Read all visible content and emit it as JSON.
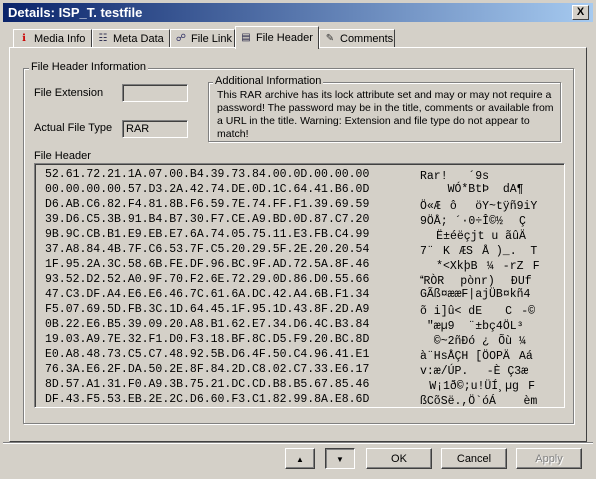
{
  "window": {
    "title": "Details: ISP_T. testfile",
    "close_label": "X"
  },
  "tabs": [
    {
      "label": "Media Info",
      "icon": "media-info-icon",
      "icon_glyph": "ℹ"
    },
    {
      "label": "Meta Data",
      "icon": "document-icon",
      "icon_glyph": "☷"
    },
    {
      "label": "File Link",
      "icon": "link-icon",
      "icon_glyph": "☍"
    },
    {
      "label": "File Header",
      "icon": "file-header-icon",
      "icon_glyph": "▤"
    },
    {
      "label": "Comments",
      "icon": "comments-icon",
      "icon_glyph": "✎"
    }
  ],
  "active_tab": "File Header",
  "file_header_info": {
    "group_title": "File Header Information",
    "extension_label": "File Extension",
    "extension_value": "",
    "type_label": "Actual File Type",
    "type_value": "RAR"
  },
  "additional_info": {
    "title": "Additional Information",
    "text": "This RAR archive has its lock attribute set and may or may not require a password! The password may be in the title, comments or available from a URL in the title. Warning: Extension and file type do not appear to match!"
  },
  "file_header": {
    "label": "File Header",
    "rows": [
      {
        "hex": "52.61.72.21.1A.07.00.B4.39.73.84.00.0D.00.00.00",
        "ascii": "Rar!   ´9s"
      },
      {
        "hex": "00.00.00.00.57.D3.2A.42.74.DE.0D.1C.64.41.B6.0D",
        "ascii": "    WÓ*BtÞ  dA¶"
      },
      {
        "hex": "D6.AB.C6.82.F4.81.8B.F6.59.7E.74.FF.F1.39.69.59",
        "ascii": "Ö«ÆôöY~tÿñ9iY"
      },
      {
        "hex": "39.D6.C5.3B.91.B4.B7.30.F7.CE.A9.BD.0D.87.C7.20",
        "ascii": "9ÖÅ;´·0÷Î©½ Ç "
      },
      {
        "hex": "9B.9C.CB.B1.E9.EB.E7.6A.74.05.75.11.E3.FB.C4.99",
        "ascii": "Ë±éëçjt u ãûÄ"
      },
      {
        "hex": "37.A8.84.4B.7F.C6.53.7F.C5.20.29.5F.2E.20.20.54",
        "ascii": "7¨KÆSÅ )_.  T"
      },
      {
        "hex": "1F.95.2A.3C.58.6B.FE.DF.96.BC.9F.AD.72.5A.8F.46",
        "ascii": " *<XkþB¼-rZF"
      },
      {
        "hex": "93.52.D2.52.A0.9F.70.F2.6E.72.29.0D.86.D0.55.66",
        "ascii": "RÒR pònr) ÐUf"
      },
      {
        "hex": "47.C3.DF.A4.E6.E6.46.7C.61.6A.DC.42.A4.6B.F1.34",
        "ascii": "GÃß¤ææF|ajÜB¤kñ4"
      },
      {
        "hex": "F5.07.69.5D.FB.3C.1D.64.45.1F.95.1D.43.8F.2D.A9",
        "ascii": "õ i]û< dE  C-©"
      },
      {
        "hex": "0B.22.E6.B5.39.09.20.A8.B1.62.E7.34.D6.4C.B3.84",
        "ascii": " \"æµ9  ¨±bç4ÖL³"
      },
      {
        "hex": "19.03.A9.7E.32.F1.D0.F3.18.BF.8C.D5.F9.20.BC.8D",
        "ascii": "  ©~2ñÐó ¿Õù ¼"
      },
      {
        "hex": "E0.A8.48.73.C5.C7.48.92.5B.D6.4F.50.C4.96.41.E1",
        "ascii": "à¨HsÅÇH[ÖOPÄAá"
      },
      {
        "hex": "76.3A.E6.2F.DA.50.2E.8F.84.2D.C8.02.C7.33.E6.17",
        "ascii": "v:æ/ÚP.-È Ç3æ "
      },
      {
        "hex": "8D.57.A1.31.F0.A9.3B.75.21.DC.CD.B8.B5.67.85.46",
        "ascii": "W¡1ð©;u!ÜÍ¸µgF"
      },
      {
        "hex": "DF.43.F5.53.EB.2E.2C.D6.60.F3.C1.82.99.8A.E8.6D",
        "ascii": "ßCõSë.,Ö`óÁèm"
      }
    ]
  },
  "footer": {
    "up_label": "▲",
    "down_label": "▼",
    "ok_label": "OK",
    "cancel_label": "Cancel",
    "apply_label": "Apply"
  }
}
